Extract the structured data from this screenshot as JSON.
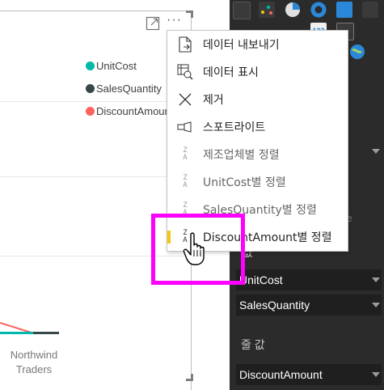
{
  "visual": {
    "more_options_label": "···",
    "legend": [
      {
        "label": "UnitCost",
        "color": "#01b8aa"
      },
      {
        "label": "SalesQuantity",
        "color": "#374649"
      },
      {
        "label": "DiscountAmount",
        "color": "#fd625e"
      }
    ],
    "axis_category": "Northwind\nTraders",
    "axis_category_line1": "Northwind",
    "axis_category_line2": "Traders"
  },
  "context_menu": {
    "items": [
      {
        "label": "데이터 내보내기",
        "icon": "export-icon"
      },
      {
        "label": "데이터 표시",
        "icon": "show-data-icon"
      },
      {
        "label": "제거",
        "icon": "close-icon"
      },
      {
        "label": "스포트라이트",
        "icon": "spotlight-icon"
      },
      {
        "label": "제조업체별 정렬",
        "icon": "sort-icon"
      },
      {
        "label": "UnitCost별 정렬",
        "icon": "sort-icon"
      },
      {
        "label": "SalesQuantity별 정렬",
        "icon": "sort-icon"
      },
      {
        "label": "DiscountAmount별 정렬",
        "icon": "sort-icon",
        "selected": true
      }
    ],
    "sort_glyph_top": "Z",
    "sort_glyph_bottom": "A",
    "sort_glyph_active_top": "Z",
    "sort_glyph_active_bottom": "A",
    "selected_indicator_color": "#f2c80f",
    "highlight_color": "#ff00ff"
  },
  "pane": {
    "partial_label_re": "re",
    "partial_label_value": "값",
    "wells": {
      "values_items": [
        "UnitCost",
        "SalesQuantity"
      ],
      "line_values_label": "줄 값",
      "line_values_items": [
        "DiscountAmount"
      ]
    },
    "viz_number_badge": "123",
    "colors": {
      "background": "#2b2b2b",
      "field": "#1f1f1f",
      "text": "#ffffff"
    }
  }
}
